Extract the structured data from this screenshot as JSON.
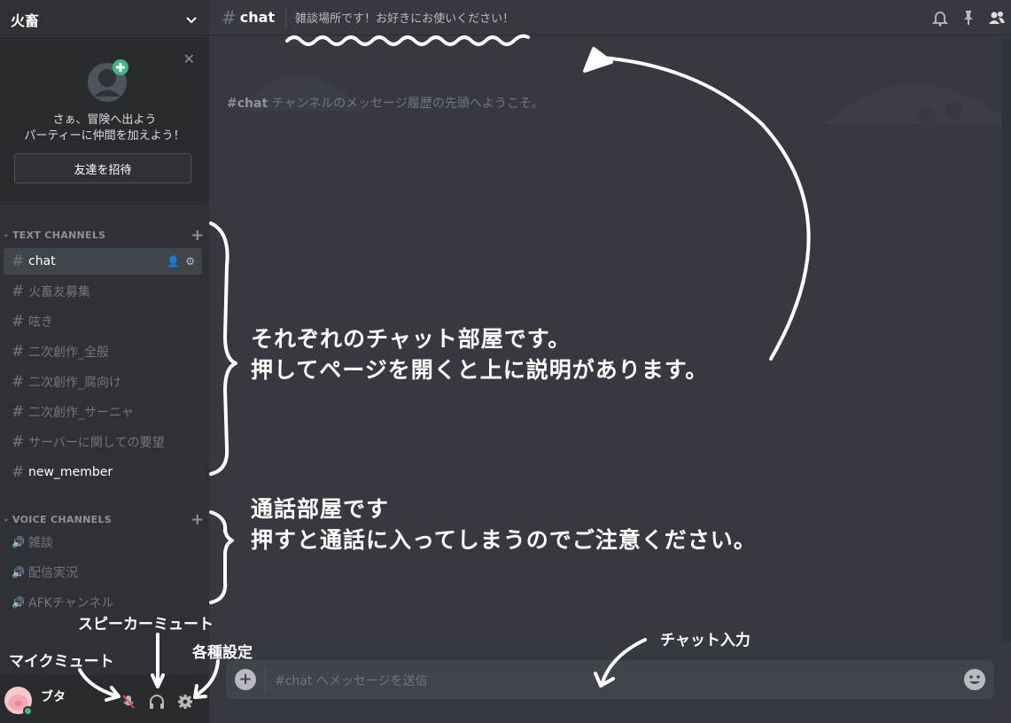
{
  "server": {
    "name": "火畜"
  },
  "invite": {
    "line1": "さぁ、冒険へ出よう",
    "line2": "パーティーに仲間を加えよう！",
    "button": "友達を招待"
  },
  "categories": {
    "text": "TEXT CHANNELS",
    "voice": "VOICE CHANNELS"
  },
  "text_channels": [
    {
      "name": "chat"
    },
    {
      "name": "火畜友募集"
    },
    {
      "name": "呟き"
    },
    {
      "name": "二次創作_全般"
    },
    {
      "name": "二次創作_腐向け"
    },
    {
      "name": "二次創作_サーニャ"
    },
    {
      "name": "サーバーに関しての要望"
    },
    {
      "name": "new_member"
    }
  ],
  "voice_channels": [
    {
      "name": "雑談"
    },
    {
      "name": "配信実況"
    },
    {
      "name": "AFKチャンネル"
    }
  ],
  "user": {
    "name": "ブタ"
  },
  "topbar": {
    "hash": "#",
    "channel": "chat",
    "topic": "雑談場所です！お好きにお使いください！"
  },
  "welcome": {
    "channel": "#chat",
    "text": "チャンネルのメッセージ履歴の先頭へようこそ。"
  },
  "composer": {
    "placeholder": "#chat へメッセージを送信"
  },
  "annotations": {
    "text_channels_1": "それぞれのチャット部屋です。",
    "text_channels_2": "押してページを開くと上に説明があります。",
    "voice_1": "通話部屋です",
    "voice_2": "押すと通話に入ってしまうのでご注意ください。",
    "speaker_mute": "スピーカーミュート",
    "mic_mute": "マイクミュート",
    "settings": "各種設定",
    "chat_input": "チャット入力"
  },
  "colors": {
    "background": "#36393f",
    "sidebar": "#2f3136",
    "online": "#43b581",
    "add_friend_badge": "#43b581"
  },
  "icons": {
    "dropdown": "chevron-down-icon",
    "close": "close-icon",
    "hash": "hash-icon",
    "speaker": "speaker-icon",
    "bell": "bell-icon",
    "pin": "pin-icon",
    "members": "members-icon",
    "mic_muted": "mic-muted-icon",
    "headphones": "headphones-icon",
    "settings": "gear-icon",
    "add": "plus-icon",
    "emoji": "emoji-icon"
  }
}
